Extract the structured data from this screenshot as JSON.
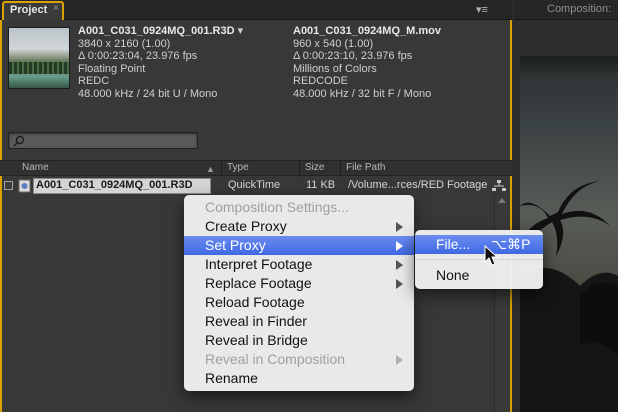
{
  "tabs": {
    "project": "Project",
    "close": "×",
    "composition": "Composition:",
    "menu": "▾≡"
  },
  "selected_footage": {
    "name": "A001_C031_0924MQ_001.R3D",
    "dropdown": "▾",
    "resolution": "3840 x 2160 (1.00)",
    "duration": "Δ 0:00:23:04, 23.976 fps",
    "color": "Floating Point",
    "codec": "REDC",
    "audio": "48.000 kHz / 24 bit U / Mono"
  },
  "proxy_footage": {
    "name": "A001_C031_0924MQ_M.mov",
    "resolution": "960 x 540 (1.00)",
    "duration": "Δ 0:00:23:10, 23.976 fps",
    "color": "Millions of Colors",
    "codec": "REDCODE",
    "audio": "48.000 kHz / 32 bit F / Mono"
  },
  "search": {
    "placeholder": ""
  },
  "columns": {
    "name": "Name",
    "type": "Type",
    "size": "Size",
    "path": "File Path"
  },
  "rows": [
    {
      "name": "A001_C031_0924MQ_001.R3D",
      "type": "QuickTime",
      "size": "11 KB",
      "path": "/Volume...rces/RED Footage"
    }
  ],
  "context_menu": {
    "items": [
      {
        "label": "Composition Settings...",
        "enabled": false,
        "submenu": false
      },
      {
        "label": "Create Proxy",
        "enabled": true,
        "submenu": true
      },
      {
        "label": "Set Proxy",
        "enabled": true,
        "submenu": true,
        "highlighted": true
      },
      {
        "label": "Interpret Footage",
        "enabled": true,
        "submenu": true
      },
      {
        "label": "Replace Footage",
        "enabled": true,
        "submenu": true
      },
      {
        "label": "Reload Footage",
        "enabled": true,
        "submenu": false
      },
      {
        "label": "Reveal in Finder",
        "enabled": true,
        "submenu": false
      },
      {
        "label": "Reveal in Bridge",
        "enabled": true,
        "submenu": false
      },
      {
        "label": "Reveal in Composition",
        "enabled": false,
        "submenu": true
      },
      {
        "label": "Rename",
        "enabled": true,
        "submenu": false
      }
    ]
  },
  "submenu": {
    "file_label": "File...",
    "file_shortcut": "⌥⌘P",
    "none_label": "None"
  },
  "colors": {
    "accent": "#d9a200",
    "highlight": "#3f68e3",
    "panel_bg": "#383838"
  }
}
